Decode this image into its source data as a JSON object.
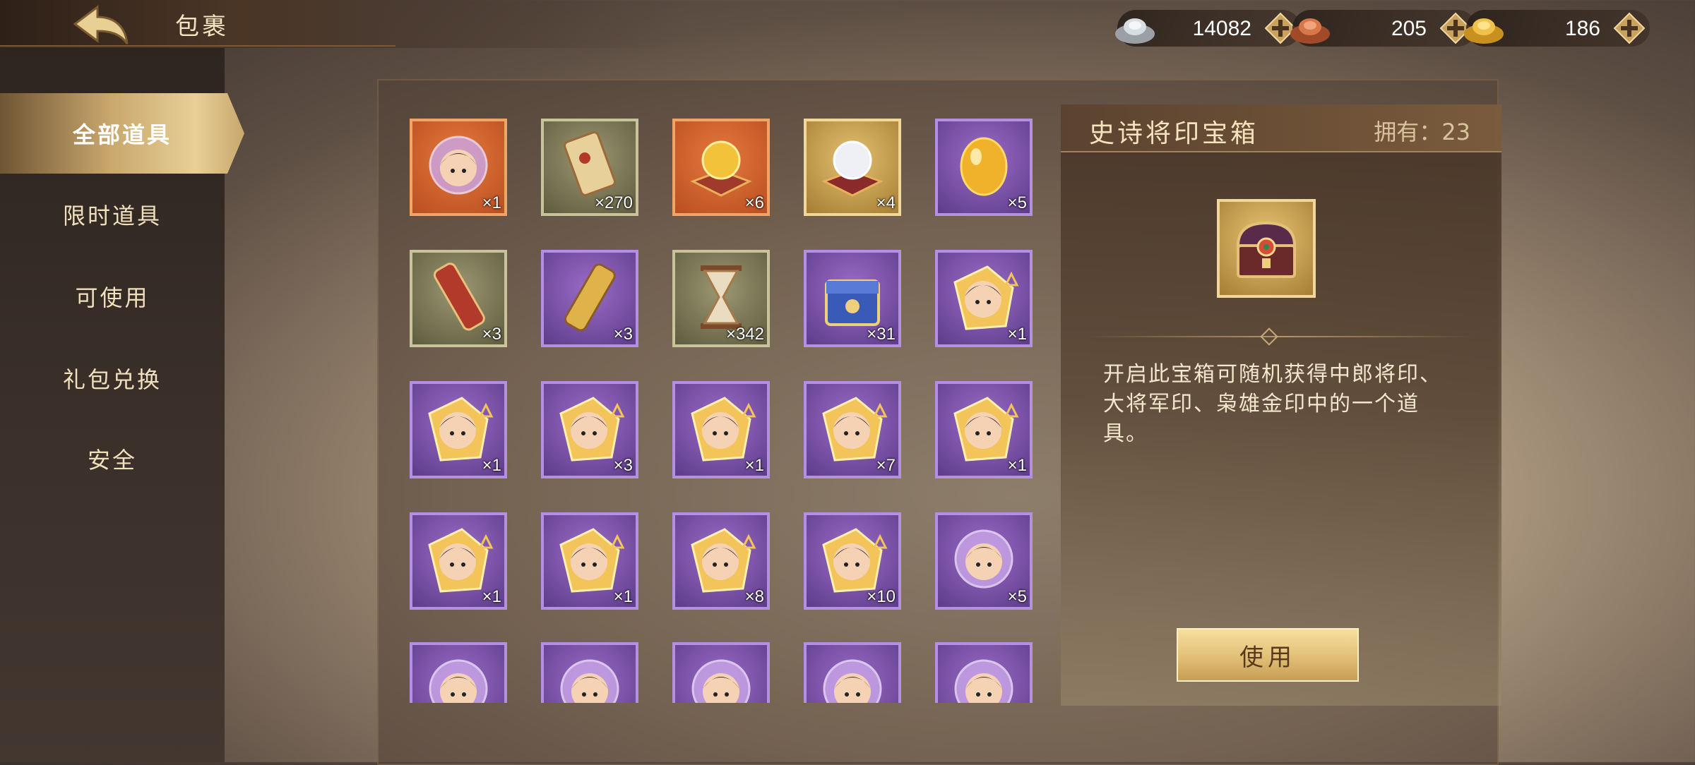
{
  "header": {
    "title": "包裹"
  },
  "currencies": [
    {
      "name": "silver",
      "value": "14082",
      "icon": "silver-ingot-icon"
    },
    {
      "name": "copper",
      "value": "205",
      "icon": "copper-ingot-icon"
    },
    {
      "name": "gold",
      "value": "186",
      "icon": "gold-ingot-icon"
    }
  ],
  "sidebar": {
    "items": [
      {
        "label": "全部道具",
        "active": true
      },
      {
        "label": "限时道具"
      },
      {
        "label": "可使用"
      },
      {
        "label": "礼包兑换"
      },
      {
        "label": "安全"
      }
    ]
  },
  "inventory": {
    "items": [
      {
        "icon": "hero-portrait-crystal-icon",
        "rarity": "orange",
        "qty": "×1"
      },
      {
        "icon": "scroll-icon",
        "rarity": "green",
        "qty": "×270"
      },
      {
        "icon": "golden-orb-icon",
        "rarity": "orange",
        "qty": "×6"
      },
      {
        "icon": "pearl-orb-icon",
        "rarity": "gold",
        "qty": "×4"
      },
      {
        "icon": "golden-egg-icon",
        "rarity": "purple",
        "qty": "×5"
      },
      {
        "icon": "red-scroll-icon",
        "rarity": "green",
        "qty": "×3"
      },
      {
        "icon": "gold-scroll-icon",
        "rarity": "purple",
        "qty": "×3"
      },
      {
        "icon": "hourglass-icon",
        "rarity": "green",
        "qty": "×342"
      },
      {
        "icon": "blue-chest-icon",
        "rarity": "purple",
        "qty": "×31"
      },
      {
        "icon": "hero-token-icon",
        "rarity": "purple",
        "qty": "×1"
      },
      {
        "icon": "hero-token-icon",
        "rarity": "purple",
        "qty": "×1"
      },
      {
        "icon": "hero-token-icon",
        "rarity": "purple",
        "qty": "×3"
      },
      {
        "icon": "hero-token-icon",
        "rarity": "purple",
        "qty": "×1"
      },
      {
        "icon": "hero-token-icon",
        "rarity": "purple",
        "qty": "×7"
      },
      {
        "icon": "hero-token-icon",
        "rarity": "purple",
        "qty": "×1"
      },
      {
        "icon": "hero-token-icon",
        "rarity": "purple",
        "qty": "×1"
      },
      {
        "icon": "hero-token-icon",
        "rarity": "purple",
        "qty": "×1"
      },
      {
        "icon": "hero-token-icon",
        "rarity": "purple",
        "qty": "×8"
      },
      {
        "icon": "hero-token-icon",
        "rarity": "purple",
        "qty": "×10"
      },
      {
        "icon": "hero-portrait-crystal-icon",
        "rarity": "purple",
        "qty": "×5"
      },
      {
        "icon": "hero-portrait-crystal-icon",
        "rarity": "purple",
        "qty": ""
      },
      {
        "icon": "hero-portrait-crystal-icon",
        "rarity": "purple",
        "qty": ""
      },
      {
        "icon": "hero-portrait-crystal-icon",
        "rarity": "purple",
        "qty": ""
      },
      {
        "icon": "hero-portrait-crystal-icon",
        "rarity": "purple",
        "qty": ""
      },
      {
        "icon": "hero-portrait-crystal-icon",
        "rarity": "purple",
        "qty": ""
      }
    ]
  },
  "detail": {
    "name": "史诗将印宝箱",
    "own_label": "拥有：23",
    "icon": "treasure-chest-icon",
    "description": "开启此宝箱可随机获得中郎将印、大将军印、枭雄金印中的一个道具。",
    "use_label": "使用"
  }
}
